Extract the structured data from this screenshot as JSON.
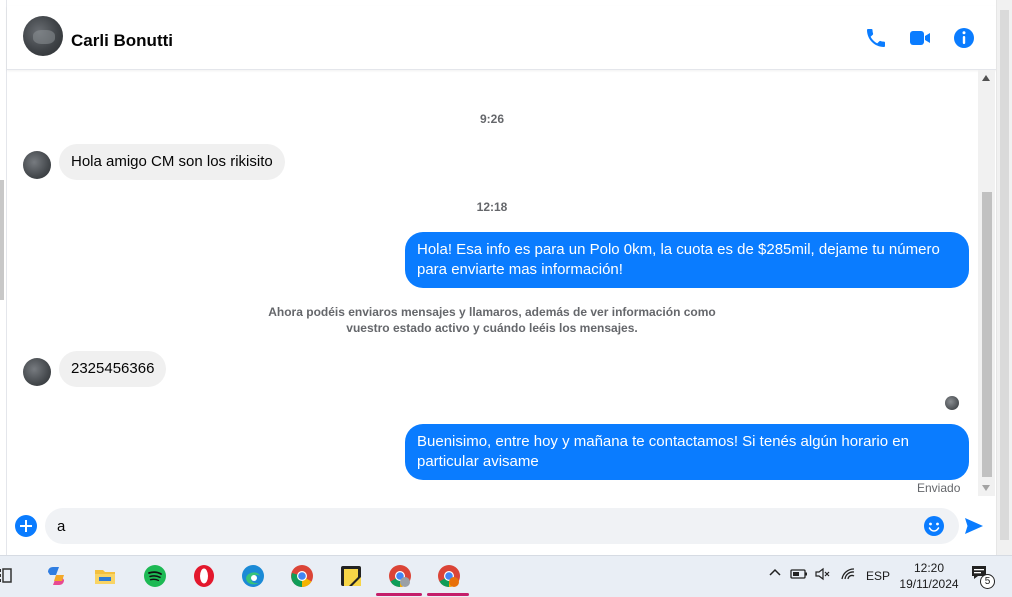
{
  "header": {
    "contact_name": "Carli Bonutti",
    "icons": [
      "phone-icon",
      "video-icon",
      "info-icon"
    ],
    "accent_color": "#0a7cff"
  },
  "conversation": {
    "timestamp_1": "9:26",
    "msg_in_1": "Hola amigo CM son los rikisito",
    "timestamp_2": "12:18",
    "msg_out_1": "Hola! Esa info es para un Polo 0km, la cuota es de $285mil, dejame tu número para enviarte mas información!",
    "system_note": "Ahora podéis enviaros mensajes y llamaros, además de ver información como vuestro estado activo y cuándo leéis los mensajes.",
    "msg_in_2": "2325456366",
    "msg_out_2": "Buenisimo, entre hoy y mañana te contactamos! Si tenés algún horario en particular avisame",
    "sent_status": "Enviado"
  },
  "composer": {
    "value": "a",
    "icons": [
      "plus-icon",
      "emoji-icon",
      "send-icon"
    ]
  },
  "taskbar": {
    "apps": [
      "task-view-icon",
      "copilot-icon",
      "file-explorer-icon",
      "spotify-icon",
      "opera-icon",
      "edge-icon",
      "chrome-icon",
      "sticky-notes-icon",
      "chrome-profile-icon",
      "chrome-profile-2-icon"
    ],
    "language": "ESP",
    "time": "12:20",
    "date": "19/11/2024",
    "notification_count": "5"
  }
}
